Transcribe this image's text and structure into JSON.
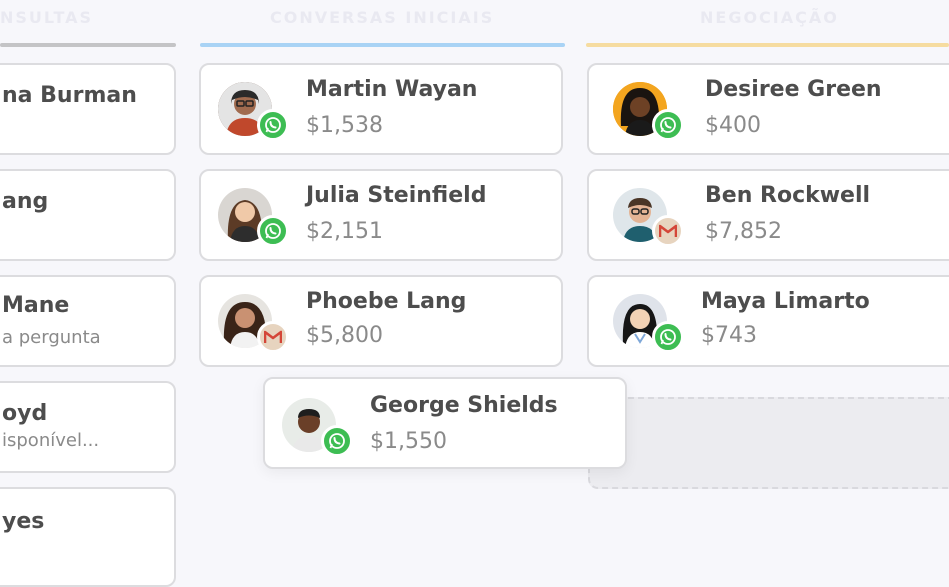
{
  "columns": [
    {
      "title": "NSULTAS",
      "color": "#c4c4c6"
    },
    {
      "title": "CONVERSAS INICIAIS",
      "color": "#a9d3f5"
    },
    {
      "title": "NEGOCIAÇÃO",
      "color": "#f6dca0"
    }
  ],
  "left_cards": [
    {
      "name": "na Burman",
      "sub": ""
    },
    {
      "name": "ang",
      "sub": ""
    },
    {
      "name": "Mane",
      "sub": "a pergunta"
    },
    {
      "name": "oyd",
      "sub": "isponível..."
    },
    {
      "name": "yes",
      "sub": ""
    }
  ],
  "cards": {
    "martin": {
      "name": "Martin Wayan",
      "amount": "$1,538",
      "channel": "whatsapp-icon"
    },
    "julia": {
      "name": "Julia Steinfield",
      "amount": "$2,151",
      "channel": "whatsapp-icon"
    },
    "phoebe": {
      "name": "Phoebe Lang",
      "amount": "$5,800",
      "channel": "gmail-icon"
    },
    "george": {
      "name": "George Shields",
      "amount": "$1,550",
      "channel": "whatsapp-icon"
    },
    "desiree": {
      "name": "Desiree Green",
      "amount": "$400",
      "channel": "whatsapp-icon"
    },
    "ben": {
      "name": "Ben Rockwell",
      "amount": "$7,852",
      "channel": "gmail-icon"
    },
    "maya": {
      "name": "Maya Limarto",
      "amount": "$743",
      "channel": "whatsapp-icon"
    }
  }
}
